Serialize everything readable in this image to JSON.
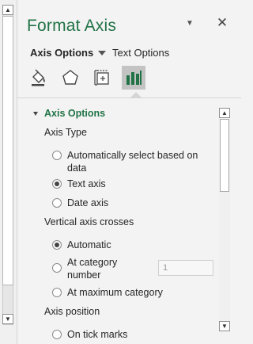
{
  "left_scrollbar": {
    "up_glyph": "▲",
    "down_glyph": "▼"
  },
  "pane": {
    "title": "Format Axis",
    "chevron_glyph": "▼",
    "close_glyph": "✕"
  },
  "tabs": {
    "axis_options": "Axis Options",
    "text_options": "Text Options"
  },
  "icons": [
    "fill-line-icon",
    "effects-icon",
    "size-properties-icon",
    "axis-options-icon"
  ],
  "section": {
    "title": "Axis Options",
    "axis_type_label": "Axis Type",
    "axis_type_options": [
      {
        "label": "Automatically select based on data",
        "selected": false
      },
      {
        "label": "Text axis",
        "selected": true
      },
      {
        "label": "Date axis",
        "selected": false
      }
    ],
    "vertical_crosses_label": "Vertical axis crosses",
    "crosses_options": [
      {
        "label": "Automatic",
        "selected": true
      },
      {
        "label": "At category number",
        "selected": false
      },
      {
        "label": "At maximum category",
        "selected": false
      }
    ],
    "category_number_value": "1",
    "axis_position_label": "Axis position",
    "axis_position_first_option": "On tick marks"
  },
  "right_scrollbar": {
    "up_glyph": "▲",
    "down_glyph": "▼"
  },
  "colors": {
    "accent": "#217346",
    "pane_bg": "#f3f3f3",
    "active_icon_bg": "#c3c3c3"
  }
}
